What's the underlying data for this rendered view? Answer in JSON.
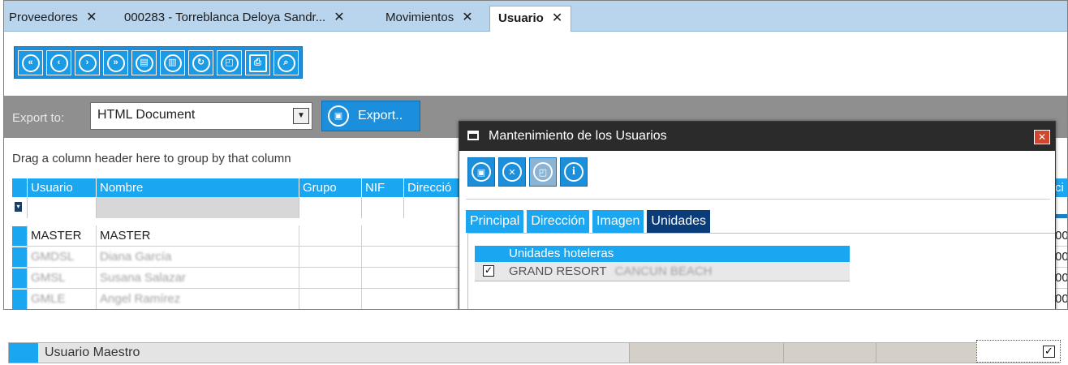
{
  "tabs": [
    {
      "label": "Proveedores",
      "close": "✕"
    },
    {
      "label": "000283 - Torreblanca Deloya Sandr...",
      "close": "✕"
    },
    {
      "label": "Movimientos",
      "close": "✕"
    },
    {
      "label": "Usuario",
      "close": "✕",
      "active": true
    }
  ],
  "toolbar": {
    "buttons": [
      {
        "name": "first-record-button",
        "icon": "first-icon",
        "glyph": "«"
      },
      {
        "name": "previous-record-button",
        "icon": "previous-icon",
        "glyph": "‹"
      },
      {
        "name": "next-record-button",
        "icon": "next-icon",
        "glyph": "›"
      },
      {
        "name": "last-record-button",
        "icon": "last-icon",
        "glyph": "»"
      },
      {
        "name": "new-record-button",
        "icon": "document-icon",
        "glyph": "▤"
      },
      {
        "name": "delete-record-button",
        "icon": "trash-icon",
        "glyph": "▥"
      },
      {
        "name": "refresh-button",
        "icon": "refresh-icon",
        "glyph": "↻"
      },
      {
        "name": "edit-record-button",
        "icon": "edit-icon",
        "glyph": "◰"
      },
      {
        "name": "print-button",
        "icon": "printer-icon",
        "glyph": "⎙"
      },
      {
        "name": "search-button",
        "icon": "search-icon",
        "glyph": "⌕"
      }
    ]
  },
  "export": {
    "label": "Export to:",
    "format": "HTML Document",
    "button_label": "Export.."
  },
  "grid": {
    "group_hint": "Drag a column header here to group by that column",
    "columns": [
      "Usuario",
      "Nombre",
      "Grupo",
      "NIF",
      "Direcció"
    ],
    "rows": [
      {
        "usuario": "MASTER",
        "nombre": "MASTER",
        "blurred": false
      },
      {
        "usuario": "GMDSL",
        "nombre": "Diana García",
        "blurred": true
      },
      {
        "usuario": "GMSL",
        "nombre": "Susana Salazar",
        "blurred": true
      },
      {
        "usuario": "GMLE",
        "nombre": "Angel Ramírez",
        "blurred": true
      }
    ],
    "right_fragment_header": "ci",
    "right_fragment_cells": [
      "00",
      "00",
      "00",
      "00"
    ]
  },
  "dialog": {
    "title": "Mantenimiento de los Usuarios",
    "close_glyph": "✕",
    "buttons": [
      {
        "name": "dialog-save-button",
        "icon": "save-icon",
        "glyph": "▣",
        "disabled": false
      },
      {
        "name": "dialog-cancel-button",
        "icon": "cancel-icon",
        "glyph": "✕",
        "disabled": false
      },
      {
        "name": "dialog-edit-button",
        "icon": "edit-icon",
        "glyph": "◰",
        "disabled": true
      },
      {
        "name": "dialog-info-button",
        "icon": "info-icon",
        "glyph": "i",
        "disabled": false
      }
    ],
    "tabs": [
      "Principal",
      "Dirección",
      "Imagen",
      "Unidades"
    ],
    "active_tab": "Unidades",
    "units_header": "Unidades hoteleras",
    "units_rows": [
      {
        "checked": true,
        "name": "GRAND RESORT",
        "name_blurred": "CANCUN BEACH"
      }
    ]
  },
  "bottom_row": {
    "label": "Usuario Maestro",
    "checked": true
  },
  "colors": {
    "accent": "#1aa6f0",
    "toolbar_blue": "#1b8fdb",
    "active_tab": "#0b3c7a",
    "tabbar": "#b9d5ee"
  }
}
